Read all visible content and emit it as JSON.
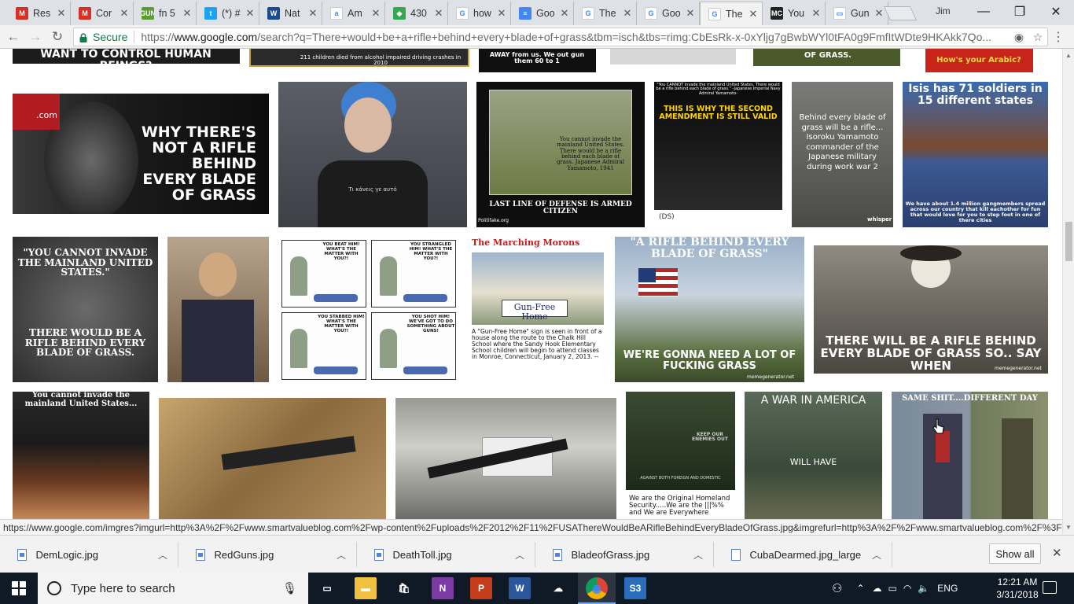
{
  "browser": {
    "tabs": [
      {
        "label": "Res",
        "icon": "gmail-icon",
        "color": "#d93025",
        "glyph": "M"
      },
      {
        "label": "Cor",
        "icon": "gmail-icon",
        "color": "#d93025",
        "glyph": "M"
      },
      {
        "label": "fn 5",
        "icon": "gun-site-icon",
        "color": "#5a9e2f",
        "glyph": "GUN"
      },
      {
        "label": "(*) #",
        "icon": "twitter-icon",
        "color": "#1da1f2",
        "glyph": "t"
      },
      {
        "label": "Nat",
        "icon": "weather-icon",
        "color": "#1a4b8c",
        "glyph": "W"
      },
      {
        "label": "Am",
        "icon": "amazon-icon",
        "color": "#ffffff",
        "glyph": "a"
      },
      {
        "label": "430",
        "icon": "maps-icon",
        "color": "#34a853",
        "glyph": "◆"
      },
      {
        "label": "how",
        "icon": "google-icon",
        "color": "#ffffff",
        "glyph": "G"
      },
      {
        "label": "Goo",
        "icon": "docs-icon",
        "color": "#4285f4",
        "glyph": "≡"
      },
      {
        "label": "The",
        "icon": "google-icon",
        "color": "#ffffff",
        "glyph": "G"
      },
      {
        "label": "Goo",
        "icon": "google-icon",
        "color": "#ffffff",
        "glyph": "G"
      },
      {
        "label": "The",
        "icon": "google-icon",
        "color": "#ffffff",
        "glyph": "G",
        "active": true
      },
      {
        "label": "You",
        "icon": "mc-icon",
        "color": "#222222",
        "glyph": "MC"
      },
      {
        "label": "Gun",
        "icon": "image-icon",
        "color": "#ffffff",
        "glyph": "▭"
      }
    ],
    "profile_name": "Jim",
    "window_controls": {
      "minimize": "—",
      "maximize": "❐",
      "close": "✕"
    },
    "nav": {
      "back": "←",
      "forward": "→",
      "reload": "↻"
    },
    "omnibox": {
      "security_label": "Secure",
      "url_scheme": "https://",
      "url_host": "www.google.com",
      "url_rest": "/search?q=There+would+be+a+rifle+behind+every+blade+of+grass&tbm=isch&tbs=rimg:CbEsRk-x-0xYljg7gBwbWYl0tFA0g9FmfItWDte9HKAkk7Qo..."
    },
    "status_url": "https://www.google.com/imgres?imgurl=http%3A%2F%2Fwww.smartvalueblog.com%2Fwp-content%2Fuploads%2F2012%2F11%2FUSAThereWouldBeARifleBehindEveryBladeOfGrass.jpg&imgrefurl=http%3A%2F%2Fwww.smartvalueblog.com%2F%3Fp..."
  },
  "results": {
    "row0": [
      {
        "text": "WANT TO CONTROL HUMAN BEINGS?"
      },
      {
        "text": "211 children died from alcohol impaired driving crashes in 2010"
      },
      {
        "text": "AWAY from us. We out gun them 60 to 1"
      },
      {
        "text": ""
      },
      {
        "text": "OF GRASS."
      },
      {
        "text": "How's your Arabic?"
      }
    ],
    "row1": [
      {
        "brand": ".com",
        "text": "WHY THERE'S NOT A RIFLE BEHIND EVERY BLADE OF GRASS"
      },
      {
        "text": "Τι κάνεις γε αυτό"
      },
      {
        "text": "You cannot invade the mainland United States. There would be a rifle behind each blade of grass. Japanese Admiral Yamamoto, 1941",
        "caption": "LAST LINE OF DEFENSE IS ARMED CITIZEN",
        "sub": "Politifake.org"
      },
      {
        "top": "\"You CANNOT invade the mainland United States. There would be a rifle behind each blade of grass.\" -Japanese Imperial Navy Admiral Yamamoto-",
        "text": "THIS IS WHY THE SECOND AMENDMENT IS STILL VALID",
        "foot": "(DS)"
      },
      {
        "text": "Behind every blade of grass will be a rifle... Isoroku Yamamoto commander of the Japanese military during work war 2",
        "sub": "whisper"
      },
      {
        "text": "Isis has 71 soldiers in 15 different states",
        "sub": "We have about 1.4 million gangmembers spread across our country that kill eachother for fun that would love for you to step foot in one of there cities"
      }
    ],
    "row2": [
      {
        "text": "\"YOU CANNOT INVADE THE MAINLAND UNITED STATES.\"",
        "sub": "THERE WOULD BE A RIFLE BEHIND EVERY BLADE OF GRASS."
      },
      {
        "text": ""
      },
      {
        "panels": [
          "YOU BEAT HIM! WHAT'S THE MATTER WITH YOU?!",
          "YOU STRANGLED HIM! WHAT'S THE MATTER WITH YOU?!",
          "YOU STABBED HIM! WHAT'S THE MATTER WITH YOU?!",
          "YOU SHOT HIM! WE'VE GOT TO DO SOMETHING ABOUT GUNS!"
        ]
      },
      {
        "title": "The Marching Morons",
        "sign": "Gun-Free Home",
        "caption": "A \"Gun-Free Home\" sign is seen in front of a house along the route to the Chalk Hill School where the Sandy Hook Elementary School children will begin to attend classes in Monroe, Connecticut, January 2, 2013. --"
      },
      {
        "text": "\"A RIFLE BEHIND EVERY BLADE OF GRASS\"",
        "sub": "WE'RE GONNA NEED A LOT OF FUCKING GRASS",
        "foot": "memegenerator.net"
      },
      {
        "text": "THERE WILL BE A RIFLE BEHIND EVERY BLADE OF GRASS SO.. SAY WHEN",
        "foot": "memegenerator.net"
      }
    ],
    "row3": [
      {
        "text": "You cannot invade the mainland United States..."
      },
      {
        "text": ""
      },
      {
        "text": ""
      },
      {
        "top": "KEEP OUR ENEMIES OUT",
        "sub": "AGAINST BOTH FOREIGN AND DOMESTIC",
        "caption": "We are the Original Homeland Security.....We are the |||%% and We are Everywhere"
      },
      {
        "text": "A WAR IN AMERICA",
        "sub": "WILL HAVE"
      },
      {
        "text": "SAME SHIT....DIFFERENT DAY"
      }
    ]
  },
  "downloads": [
    {
      "name": "DemLogic.jpg",
      "type": "image"
    },
    {
      "name": "RedGuns.jpg",
      "type": "image"
    },
    {
      "name": "DeathToll.jpg",
      "type": "image"
    },
    {
      "name": "BladeofGrass.jpg",
      "type": "image"
    },
    {
      "name": "CubaDearmed.jpg_large",
      "type": "file"
    }
  ],
  "show_all_label": "Show all",
  "taskbar": {
    "search_placeholder": "Type here to search",
    "apps": [
      {
        "name": "task-view-icon",
        "glyph": "▭",
        "color": "transparent"
      },
      {
        "name": "file-explorer-icon",
        "glyph": "▬",
        "color": "#f0c040"
      },
      {
        "name": "store-icon",
        "glyph": "🛍",
        "color": "transparent"
      },
      {
        "name": "onenote-icon",
        "glyph": "N",
        "color": "#7b3aa6"
      },
      {
        "name": "powerpoint-icon",
        "glyph": "P",
        "color": "#c43e1c"
      },
      {
        "name": "word-icon",
        "glyph": "W",
        "color": "#2b579a"
      },
      {
        "name": "onedrive-icon",
        "glyph": "☁",
        "color": "transparent"
      },
      {
        "name": "chrome-icon",
        "glyph": "◉",
        "color": "transparent"
      },
      {
        "name": "s3-icon",
        "glyph": "S3",
        "color": "#2a6ebb"
      }
    ],
    "language": "ENG",
    "time": "12:21 AM",
    "date": "3/31/2018"
  }
}
